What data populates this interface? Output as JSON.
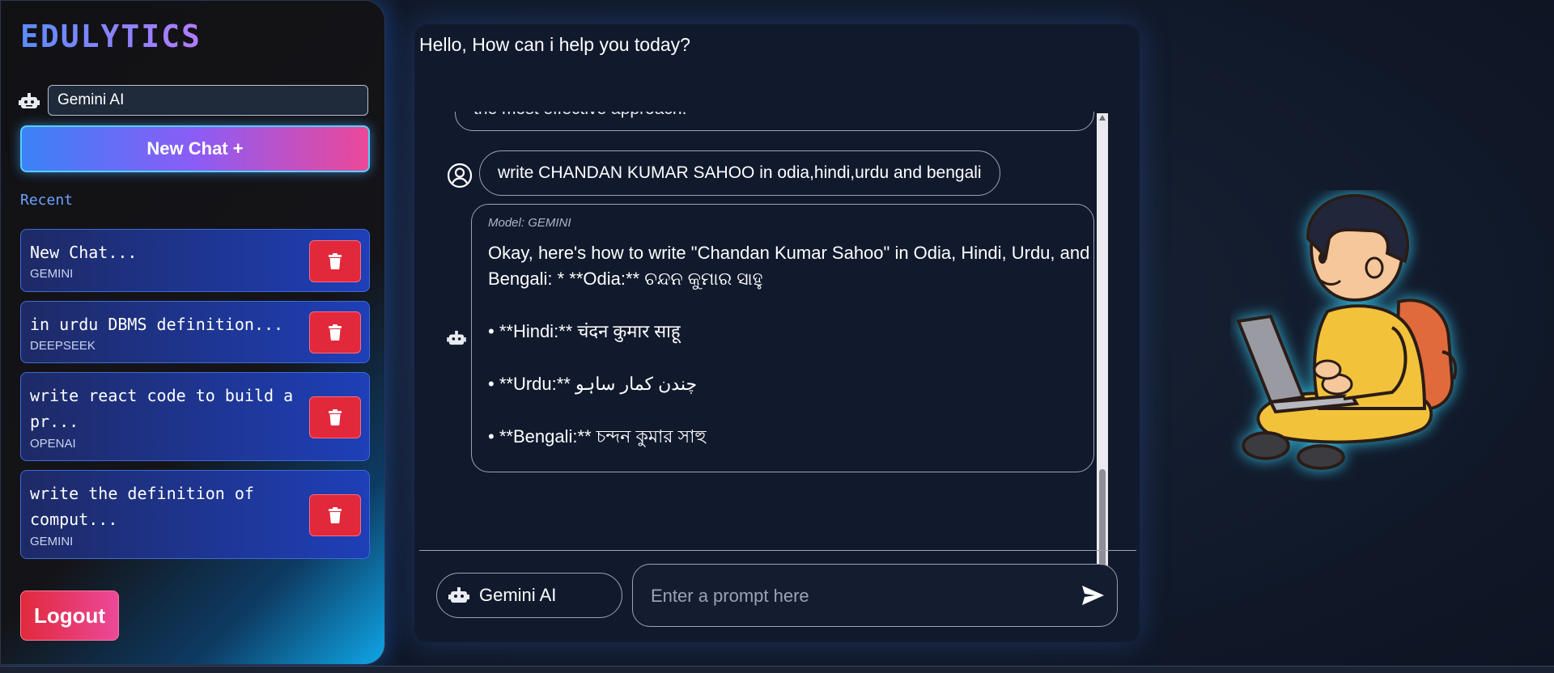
{
  "sidebar": {
    "brand": "EDULYTICS",
    "model_field_value": "Gemini AI",
    "new_chat_label": "New Chat +",
    "recent_label": "Recent",
    "chats": [
      {
        "title": "New Chat...",
        "model": "GEMINI"
      },
      {
        "title": "in urdu DBMS definition...",
        "model": "DEEPSEEK"
      },
      {
        "title": "write react code to build a pr...",
        "model": "OPENAI"
      },
      {
        "title": "write the definition of comput...",
        "model": "GEMINI"
      }
    ],
    "logout_label": "Logout"
  },
  "main": {
    "greeting": "Hello, How can i help you today?",
    "cutoff_text": "the most effective approach.",
    "user_message": "write CHANDAN KUMAR SAHOO in odia,hindi,urdu and bengali",
    "bot_meta": "Model: GEMINI",
    "bot_lines": [
      "Okay, here's how to write \"Chandan Kumar Sahoo\" in Odia, Hindi, Urdu, and",
      "Bengali: * **Odia:** ଚନ୍ଦନ କୁମାର ସାହୁ",
      "• **Hindi:** चंदन कुमार साहू",
      "• **Urdu:** چندن کمار ساہو",
      "• **Bengali:** চন্দন কুমার সাহু"
    ],
    "model_pill_label": "Gemini AI",
    "prompt_placeholder": "Enter a prompt here"
  },
  "colors": {
    "accent_blue": "#3b82f6",
    "accent_pink": "#ec4899",
    "delete_red": "#e2283b",
    "panel_bg": "#111a2d"
  },
  "icons": [
    "robot-icon",
    "trash-icon",
    "user-circle-icon",
    "send-icon"
  ]
}
